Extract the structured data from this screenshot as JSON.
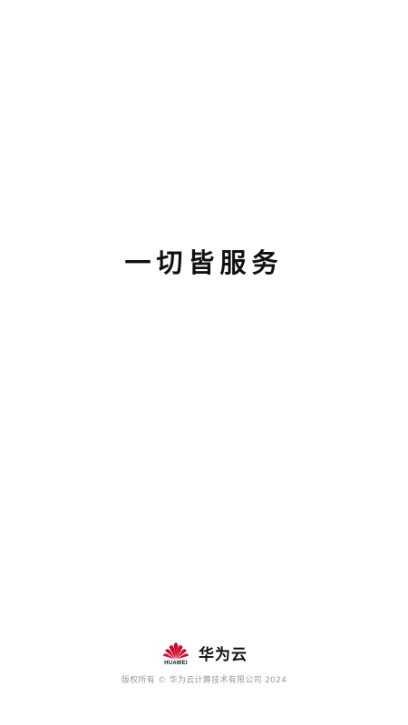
{
  "splash": {
    "slogan": "一切皆服务",
    "brand": {
      "logo_icon": "huawei-flower-icon",
      "logo_wordmark": "HUAWEI",
      "product_name": "华为云",
      "accent_color": "#cf0a2c"
    },
    "footer": {
      "copyright": "版权所有 © 华为云计算技术有限公司 2024"
    }
  }
}
